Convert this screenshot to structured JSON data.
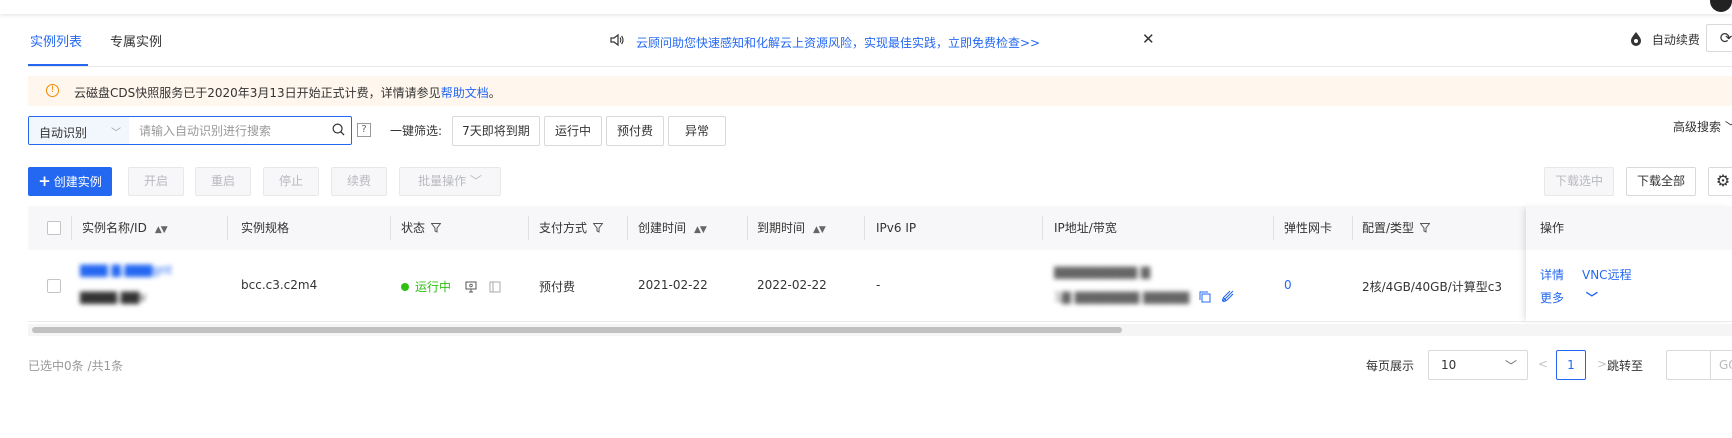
{
  "tabs": [
    {
      "label": "实例列表",
      "active": true
    },
    {
      "label": "专属实例",
      "active": false
    }
  ],
  "notice": {
    "text": "云顾问助您快速感知和化解云上资源风险，实现最佳实践，立即免费检查>>"
  },
  "auto_renew": {
    "label": "自动续费"
  },
  "alert": {
    "text": "云磁盘CDS快照服务已于2020年3月13日开始正式计费，详情请参见",
    "link": "帮助文档",
    "suffix": "。"
  },
  "search": {
    "type": "自动识别",
    "placeholder": "请输入自动识别进行搜索",
    "help": "?"
  },
  "quick_filter": {
    "label": "一键筛选:",
    "options": [
      "7天即将到期",
      "运行中",
      "预付费",
      "异常"
    ]
  },
  "advanced_search": "高级搜索",
  "toolbar": {
    "create": "创建实例",
    "start": "开启",
    "restart": "重启",
    "stop": "停止",
    "renew": "续费",
    "batch": "批量操作",
    "download_selected": "下载选中",
    "download_all": "下载全部"
  },
  "table": {
    "columns": [
      "实例名称/ID",
      "实例规格",
      "状态",
      "支付方式",
      "创建时间",
      "到期时间",
      "IPv6 IP",
      "IP地址/带宽",
      "弹性网卡",
      "配置/类型",
      "操作"
    ],
    "rows": [
      {
        "name": "▇▇▇ ▇.▇▇▇gnt",
        "id": "▇▇▇▇.▇▇v",
        "spec": "bcc.c3.c2m4",
        "status": "运行中",
        "payment": "预付费",
        "created": "2021-02-22",
        "expires": "2022-02-22",
        "ipv6": "-",
        "ip_line1": "▇▇▇▇▇▇▇▇▇ ▇",
        "ip_line2": "1▇ ▇▇▇▇▇▇▇ ▇▇▇▇▇",
        "eni": "0",
        "config": "2核/4GB/40GB/计算型c3",
        "ops": {
          "detail": "详情",
          "vnc": "VNC远程",
          "more": "更多"
        }
      }
    ]
  },
  "footer": {
    "selected": "已选中0条 /共1条",
    "per_page_label": "每页展示",
    "per_page": "10",
    "prev": "<",
    "page": "1",
    "next": ">",
    "jump_label": "跳转至",
    "go": "GO"
  },
  "colors": {
    "primary": "#2468f2",
    "success": "#30bf13",
    "warning": "#f38900"
  }
}
